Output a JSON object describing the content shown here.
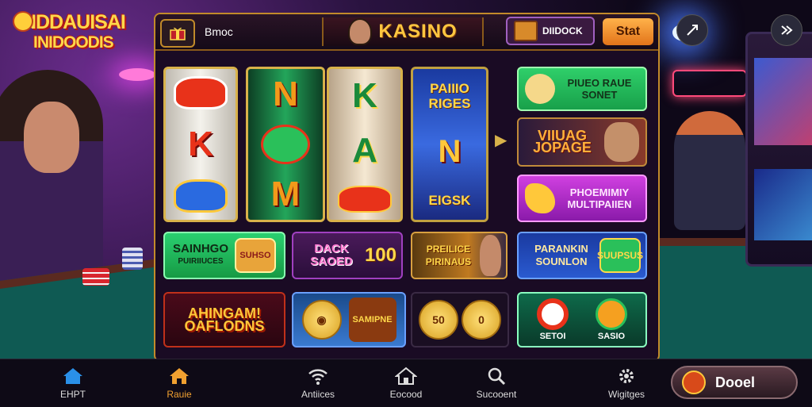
{
  "logo": {
    "line1": "INDDAUISAI",
    "line2": "INIDOODIS"
  },
  "header": {
    "menu_label": "Bmoc",
    "title": "KASINO",
    "promo_label": "DIIDOCK",
    "start_label": "Stat"
  },
  "reels": {
    "reel_a": [
      "K"
    ],
    "reel_b": [
      "N",
      "M"
    ],
    "reel_c": [
      "K",
      "A"
    ],
    "reel_d": {
      "top_text": "PAIIIO RIGES",
      "symbol": "N",
      "bottom_text": "EIGSK"
    }
  },
  "side_cards": [
    {
      "text": "PIUEO RAUE SONET"
    },
    {
      "text": "VIIUAG JOPAGE"
    },
    {
      "text": "PHOEMIMIY MULTIPAIIEN"
    }
  ],
  "tiles": {
    "t1": {
      "title": "SAINHGO",
      "sub": "PUIRIIUCES",
      "badge": "SUHSO"
    },
    "t2": {
      "title": "DACK SAOED",
      "badge": "100"
    },
    "t3": {
      "title": "PREILICE PIRINAUS"
    },
    "t4": {
      "title": "PARANKIN SOUNLON",
      "badge": "SUUPSUS"
    },
    "t5": {
      "title": "AHINGAM! OAFLODNS"
    },
    "t6": {
      "badge": "SAMIPNE"
    },
    "t7": {
      "coin1": "50",
      "coin2": "0"
    },
    "t8": {
      "label1": "SETOI",
      "label2": "SASIO"
    }
  },
  "nav": {
    "items": [
      {
        "label": "EHPT"
      },
      {
        "label": "Rauie"
      },
      {
        "label": "Antiices"
      },
      {
        "label": "Eocood"
      },
      {
        "label": "Sucooent"
      },
      {
        "label": "Wigitges"
      }
    ],
    "deposit_label": "Dooel"
  },
  "colors": {
    "accent": "#f0a030",
    "brand_gold": "#ffc640",
    "panel_border": "#c28a2a"
  }
}
